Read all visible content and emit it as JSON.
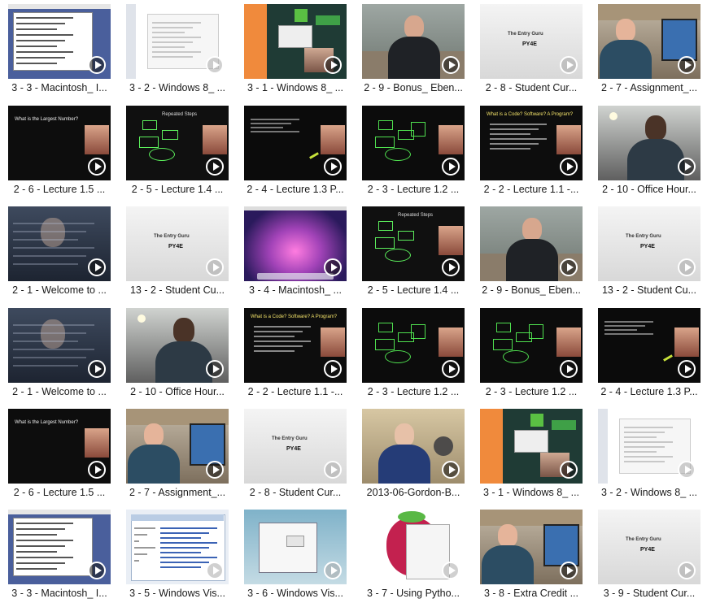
{
  "videos": [
    {
      "title": "3 - 3 - Macintosh_ I...",
      "style": "mac"
    },
    {
      "title": "3 - 2 - Windows 8_ ...",
      "style": "win8doc"
    },
    {
      "title": "3 - 1 - Windows 8_ ...",
      "style": "win8install"
    },
    {
      "title": "2 - 9 - Bonus_ Eben...",
      "style": "man_office"
    },
    {
      "title": "2 - 8 - Student Cur...",
      "style": "logo_slide"
    },
    {
      "title": "2 - 7 - Assignment_...",
      "style": "man_laptop"
    },
    {
      "title": "2 - 6 - Lecture 1.5 ...",
      "style": "slide_dark"
    },
    {
      "title": "2 - 5 - Lecture 1.4 ...",
      "style": "slide_flow"
    },
    {
      "title": "2 - 4 - Lecture 1.3 P...",
      "style": "slide_code"
    },
    {
      "title": "2 - 3 - Lecture 1.2 ...",
      "style": "slide_flow2"
    },
    {
      "title": "2 - 2 - Lecture 1.1 -...",
      "style": "slide_program"
    },
    {
      "title": "2 - 10 - Office Hour...",
      "style": "office_hour"
    },
    {
      "title": "2 - 1 - Welcome to ...",
      "style": "welcome"
    },
    {
      "title": "13 - 2 - Student Cu...",
      "style": "logo_slide"
    },
    {
      "title": "3 - 4 - Macintosh_ ...",
      "style": "mac_desktop"
    },
    {
      "title": "2 - 5 - Lecture 1.4 ...",
      "style": "slide_flow"
    },
    {
      "title": "2 - 9 - Bonus_ Eben...",
      "style": "man_office"
    },
    {
      "title": "13 - 2 - Student Cu...",
      "style": "logo_slide"
    },
    {
      "title": "2 - 1 - Welcome to ...",
      "style": "welcome"
    },
    {
      "title": "2 - 10 - Office Hour...",
      "style": "office_hour"
    },
    {
      "title": "2 - 2 - Lecture 1.1 -...",
      "style": "slide_program"
    },
    {
      "title": "2 - 3 - Lecture 1.2 ...",
      "style": "slide_flow2"
    },
    {
      "title": "2 - 3 - Lecture 1.2 ...",
      "style": "slide_flow2"
    },
    {
      "title": "2 - 4 - Lecture 1.3 P...",
      "style": "slide_code"
    },
    {
      "title": "2 - 6 - Lecture 1.5 ...",
      "style": "slide_dark"
    },
    {
      "title": "2 - 7 - Assignment_...",
      "style": "man_laptop"
    },
    {
      "title": "2 - 8 - Student Cur...",
      "style": "logo_slide"
    },
    {
      "title": "2013-06-Gordon-B...",
      "style": "gordon"
    },
    {
      "title": "3 - 1 - Windows 8_ ...",
      "style": "win8install"
    },
    {
      "title": "3 - 2 - Windows 8_ ...",
      "style": "win8doc"
    },
    {
      "title": "3 - 3 - Macintosh_ I...",
      "style": "mac"
    },
    {
      "title": "3 - 5 - Windows Vis...",
      "style": "vista_browser"
    },
    {
      "title": "3 - 6 - Windows Vis...",
      "style": "vista_window"
    },
    {
      "title": "3 - 7 - Using Pytho...",
      "style": "raspberry"
    },
    {
      "title": "3 - 8 - Extra Credit ...",
      "style": "man_laptop"
    },
    {
      "title": "3 - 9 - Student Cur...",
      "style": "logo_slide"
    }
  ],
  "slide_text": {
    "largest_number": "What is the Largest Number?",
    "repeated_steps": "Repeated Steps",
    "what_is_code": "What is a Code? Software? A Program?",
    "logo_line": "The Entry Guru",
    "logo_sub": "PY4E"
  }
}
